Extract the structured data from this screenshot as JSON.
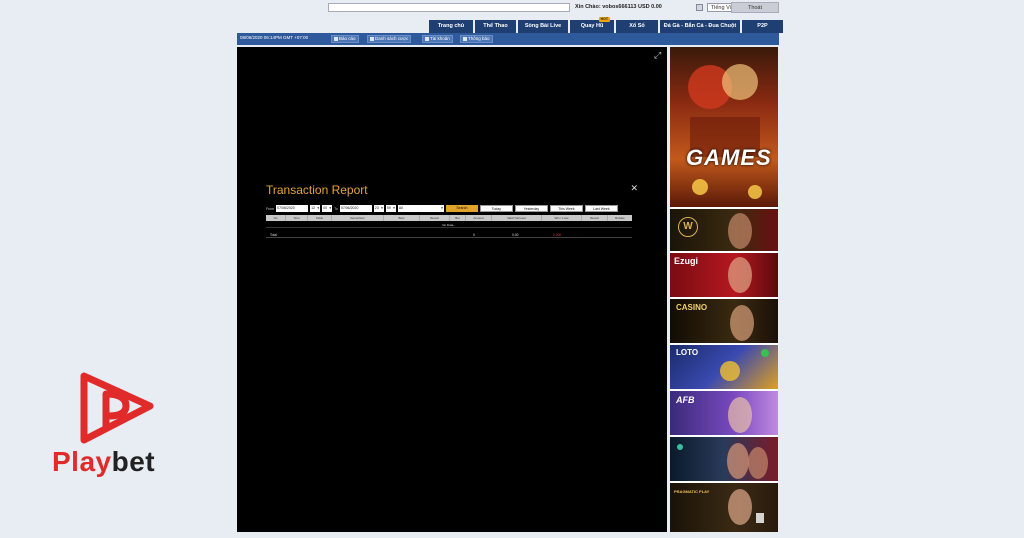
{
  "topbar": {
    "greeting_label": "Xin Chào:",
    "username": "vobos666113",
    "balance": "USD 0.00",
    "language": "Tiếng Việt",
    "logout_label": "Thoát"
  },
  "nav": {
    "tabs": [
      {
        "label": "Trang chủ"
      },
      {
        "label": "Thể Thao"
      },
      {
        "label": "Sòng Bài Live"
      },
      {
        "label": "Quay Hũ",
        "badge": "HOT"
      },
      {
        "label": "Xổ Số"
      },
      {
        "label": "Đá Gà - Bắn Cá - Đua Chuột"
      },
      {
        "label": "P2P"
      }
    ]
  },
  "subbar": {
    "datetime": "08/06/2020 06:14PM GMT +07:00",
    "buttons": [
      {
        "label": "Báo cáo",
        "icon": "report-icon"
      },
      {
        "label": "Danh sách cược",
        "icon": "list-icon"
      },
      {
        "label": "Tài khoản",
        "icon": "account-icon"
      },
      {
        "label": "Thông báo",
        "icon": "notification-icon"
      }
    ]
  },
  "report": {
    "title": "Transaction Report",
    "from_label": "From",
    "from_date": "07/06/2020",
    "from_hour": "12",
    "from_min": "00",
    "to_label": "To",
    "to_date": "07/06/2020",
    "to_hour": "23",
    "to_min": "59",
    "filter_value": "All",
    "search_label": "Search",
    "quick_buttons": [
      "Today",
      "Yesterday",
      "This Week",
      "Last Week"
    ],
    "columns": [
      "No",
      "Time",
      "Table",
      "Game/Item",
      "Bets",
      "Result",
      "Bet",
      "Amount",
      "Valid Turnover",
      "Win / Loss",
      "Result",
      "Rebate"
    ],
    "no_data": "No Data...",
    "total_label": "Total",
    "total_bet": "0",
    "total_turnover": "0.00",
    "total_winloss": "0.000"
  },
  "sidebar": {
    "banners": [
      {
        "label": "GAMES",
        "icon": "games-banner"
      },
      {
        "label": "W",
        "icon": "w-casino-banner"
      },
      {
        "label": "Ezugi",
        "icon": "ezugi-banner"
      },
      {
        "label": "CASINO",
        "icon": "casino-banner"
      },
      {
        "label": "LOTO",
        "icon": "loto-banner"
      },
      {
        "label": "AFB",
        "icon": "afb-banner"
      },
      {
        "label": "",
        "icon": "live-banner"
      },
      {
        "label": "PRAGMATIC PLAY",
        "icon": "pragmatic-banner"
      }
    ]
  },
  "logo": {
    "brand_red": "Play",
    "brand_dark": "bet",
    "color": "#e12a2a"
  }
}
